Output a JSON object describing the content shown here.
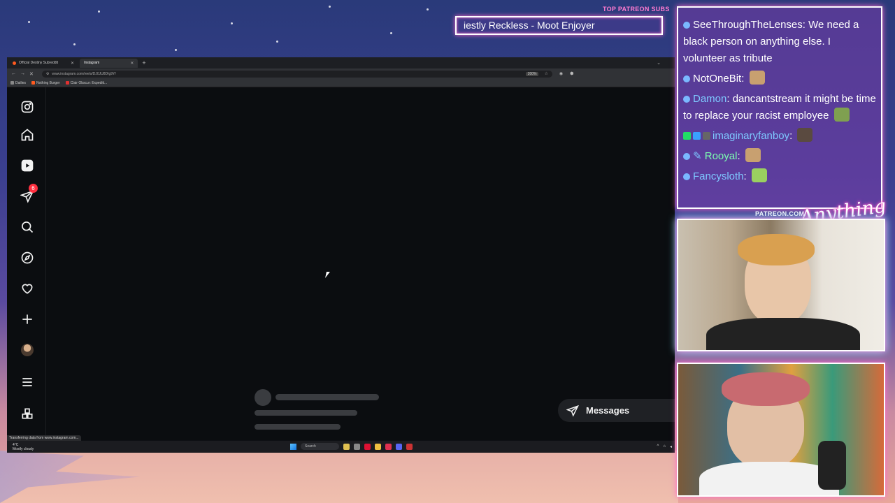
{
  "stream": {
    "top_label": "TOP PATREON SUBS",
    "ticker_text": "iestly Reckless - Moot Enjoyer",
    "patreon_url": "PATREON.COM/",
    "anything_else": "Anything else?"
  },
  "browser": {
    "tabs": [
      {
        "label": "Official Destiny Subreddit",
        "active": false
      },
      {
        "label": "Instagram",
        "active": true
      }
    ],
    "url": "www.instagram.com/reels/DJ0JU8DIg9Y/",
    "zoom": "200%",
    "bookmarks": [
      "Dailies",
      "Nothing Burger",
      "Clair Obscur: Expediti..."
    ],
    "status_text": "Transferring data from www.instagram.com...",
    "weather": {
      "temp": "4°C",
      "condition": "Mostly cloudy"
    },
    "taskbar_search": "Search"
  },
  "instagram": {
    "sidenav": [
      {
        "name": "instagram-logo-icon"
      },
      {
        "name": "home-icon"
      },
      {
        "name": "reels-icon"
      },
      {
        "name": "direct-icon",
        "badge": "6"
      },
      {
        "name": "search-icon"
      },
      {
        "name": "explore-icon"
      },
      {
        "name": "notifications-icon"
      },
      {
        "name": "create-icon"
      },
      {
        "name": "profile-avatar"
      },
      {
        "name": "more-menu-icon"
      },
      {
        "name": "also-from-meta-icon"
      }
    ],
    "messages_label": "Messages"
  },
  "chat": {
    "messages": [
      {
        "user": "SeeThroughTheLenses",
        "user_color": "#ffffff",
        "text": "We need a black person on anything else. I volunteer as tribute"
      },
      {
        "user": "NotOneBit",
        "user_color": "#ffffff",
        "text": ""
      },
      {
        "user": "Damon",
        "user_color": "#7ec8ff",
        "text": "dancantstream it might be time to replace your racist employee"
      },
      {
        "user": "imaginaryfanboy",
        "user_color": "#7ec8ff",
        "text": ""
      },
      {
        "user": "Rooyal",
        "user_color": "#7cffb0",
        "text": ""
      },
      {
        "user": "Fancysloth",
        "user_color": "#7ec8ff",
        "text": ""
      }
    ]
  },
  "colors": {
    "ticker_glow": "#ff66cc",
    "badge_red": "#ff3040"
  }
}
